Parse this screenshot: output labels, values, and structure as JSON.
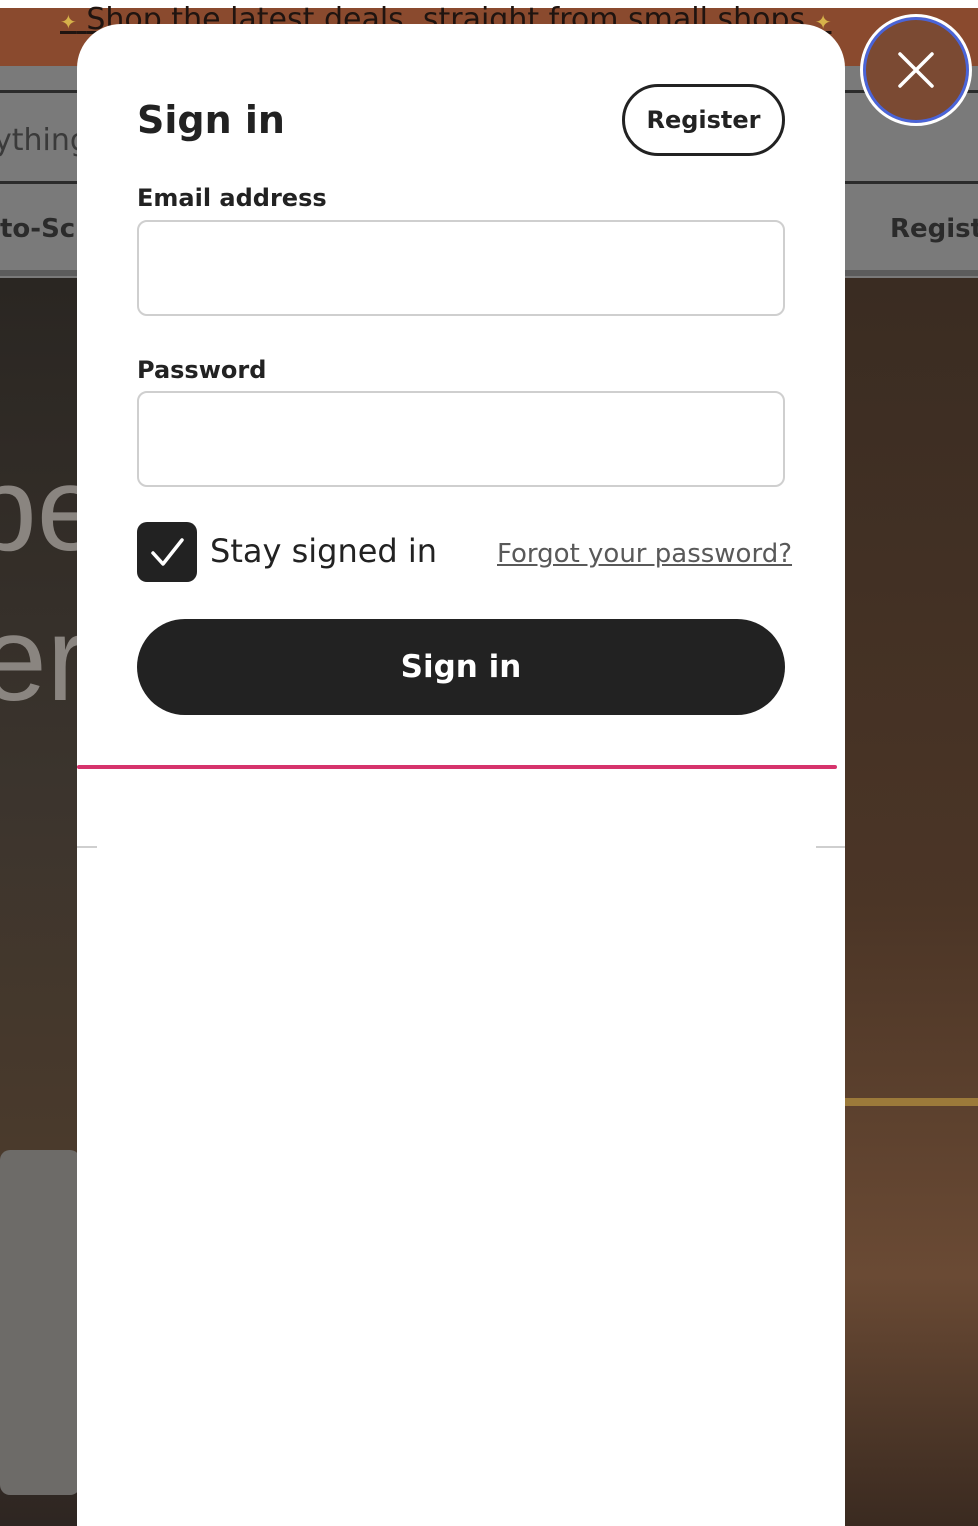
{
  "background": {
    "banner_text": "Shop the latest deals, straight from small shops",
    "search_partial": "ything",
    "nav_left_partial": "to-Sch",
    "nav_right_partial": "Registr",
    "hero_partial_1": "pe",
    "hero_partial_2": "er"
  },
  "close_button": {
    "icon": "close-icon"
  },
  "modal": {
    "title": "Sign in",
    "register_label": "Register",
    "email": {
      "label": "Email address",
      "value": "",
      "placeholder": ""
    },
    "password": {
      "label": "Password",
      "value": "",
      "placeholder": ""
    },
    "stay_signed_in": {
      "label": "Stay signed in",
      "checked": true
    },
    "forgot_password_label": "Forgot your password?",
    "submit_label": "Sign in"
  },
  "colors": {
    "primary_dark": "#222222",
    "progress_accent": "#d6336c",
    "focus_ring": "#4a64d8",
    "banner": "#8a4a2e"
  }
}
